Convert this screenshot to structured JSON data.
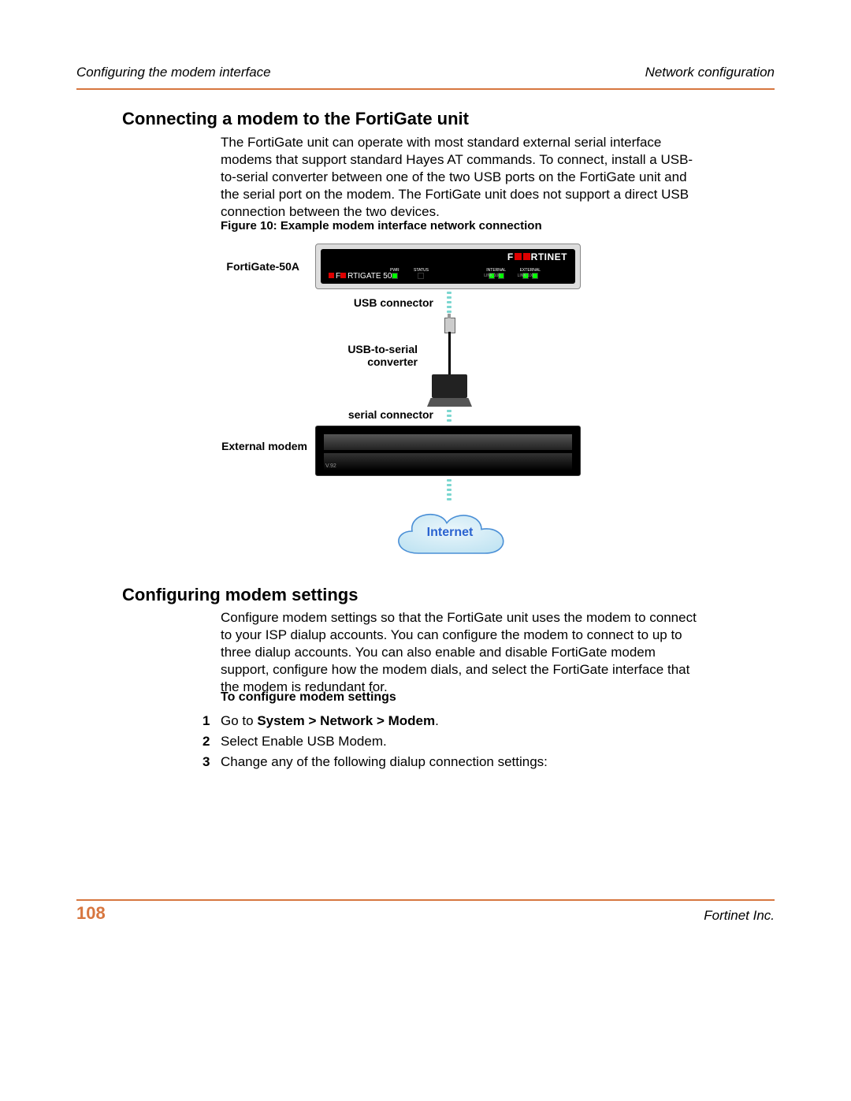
{
  "header": {
    "left": "Configuring the modem interface",
    "right": "Network configuration"
  },
  "section1": {
    "title": "Connecting a modem to the FortiGate unit",
    "para": "The FortiGate unit can operate with most standard external serial interface modems that support standard Hayes AT commands. To connect, install a USB-to-serial converter between one of the two USB ports on the FortiGate unit and the serial port on the modem. The FortiGate unit does not support a direct USB connection between the two devices."
  },
  "figure": {
    "caption": "Figure 10: Example modem interface network connection",
    "labels": {
      "fortigate": "FortiGate-50A",
      "usb_connector": "USB connector",
      "usb_to_serial1": "USB-to-serial",
      "usb_to_serial2": "converter",
      "serial_connector": "serial connector",
      "external_modem": "External modem",
      "cloud": "Internet"
    },
    "device": {
      "brand_pre": "F",
      "brand_post": "RTINET",
      "product_pre": "F",
      "product_post": "RTIGATE",
      "product_suffix": " 50A",
      "leds": {
        "pwr": "PWR",
        "status": "STATUS",
        "internal": "INTERNAL",
        "external": "EXTERNAL",
        "link100": "LINK 100",
        "link100b": "LINK 100"
      }
    },
    "modem": {
      "v92": "V.92"
    }
  },
  "section2": {
    "title": "Configuring modem settings",
    "para": "Configure modem settings so that the FortiGate unit uses the modem to connect to your ISP dialup accounts. You can configure the modem to connect to up to three dialup accounts. You can also enable and disable FortiGate modem support, configure how the modem dials, and select the FortiGate interface that the modem is redundant for.",
    "sub": "To configure modem settings",
    "steps": [
      {
        "n": "1",
        "pre": "Go to ",
        "bold": "System > Network > Modem",
        "post": "."
      },
      {
        "n": "2",
        "pre": "Select Enable USB Modem.",
        "bold": "",
        "post": ""
      },
      {
        "n": "3",
        "pre": "Change any of the following dialup connection settings:",
        "bold": "",
        "post": ""
      }
    ]
  },
  "footer": {
    "page": "108",
    "company": "Fortinet Inc."
  }
}
